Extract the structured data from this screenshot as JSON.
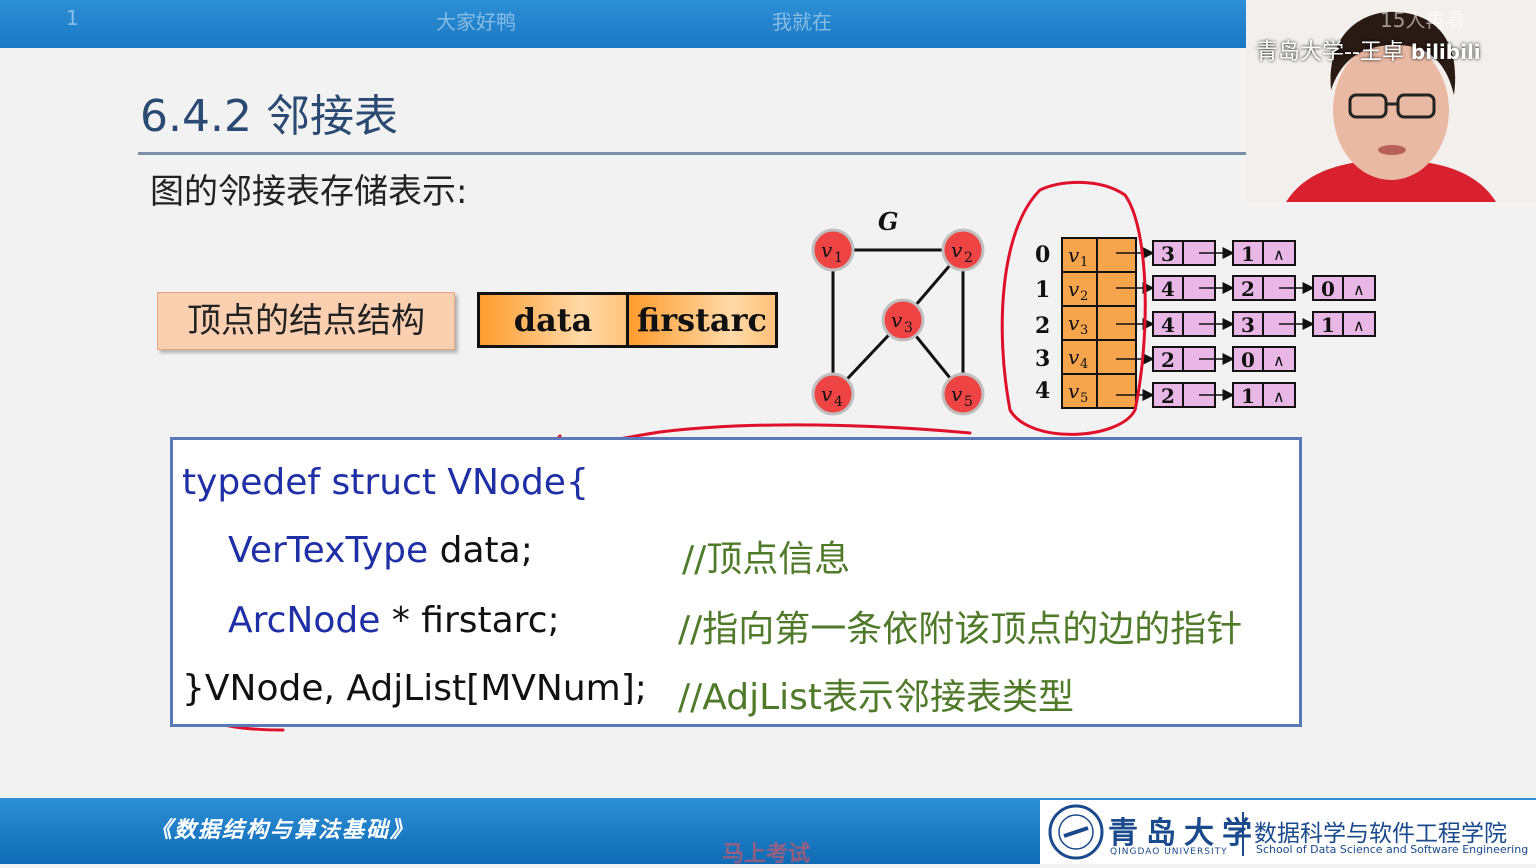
{
  "danmaku": [
    "1",
    "大家好鸭",
    "我就在"
  ],
  "webcam": {
    "caption": "青岛大学--王卓",
    "platform": "bilibili",
    "viewers": "15人再看"
  },
  "slide": {
    "title": "6.4.2 邻接表",
    "subtitle": "图的邻接表存储表示:",
    "struct_label": "顶点的结点结构",
    "node_fields": [
      "data",
      "firstarc"
    ]
  },
  "graph": {
    "name": "G",
    "vertices": [
      {
        "sub": "1"
      },
      {
        "sub": "2"
      },
      {
        "sub": "3"
      },
      {
        "sub": "4"
      },
      {
        "sub": "5"
      }
    ],
    "edges": [
      [
        "1",
        "2"
      ],
      [
        "1",
        "4"
      ],
      [
        "2",
        "3"
      ],
      [
        "2",
        "5"
      ],
      [
        "3",
        "4"
      ],
      [
        "3",
        "5"
      ]
    ]
  },
  "adjacency_list": {
    "indices": [
      "0",
      "1",
      "2",
      "3",
      "4"
    ],
    "rows": [
      {
        "vertex": "1",
        "arcs": [
          "3",
          "1"
        ]
      },
      {
        "vertex": "2",
        "arcs": [
          "4",
          "2",
          "0"
        ]
      },
      {
        "vertex": "3",
        "arcs": [
          "4",
          "3",
          "1"
        ]
      },
      {
        "vertex": "4",
        "arcs": [
          "2",
          "0"
        ]
      },
      {
        "vertex": "5",
        "arcs": [
          "2",
          "1"
        ]
      }
    ],
    "null_symbol": "∧"
  },
  "code": {
    "line1": "typedef struct VNode{",
    "line2_type": "VerTexType",
    "line2_var": " data;",
    "line2_comment": "//顶点信息",
    "line3_type": "ArcNode",
    "line3_var": " * firstarc;",
    "line3_comment": "//指向第一条依附该顶点的边的指针",
    "line4": "}VNode, AdjList[MVNum];",
    "line4_comment": "//AdjList表示邻接表类型"
  },
  "footer": {
    "course": "《数据结构与算法基础》",
    "exam_danmaku": "马上考试",
    "university": "青岛大学",
    "university_en": "QINGDAO UNIVERSITY",
    "school": "数据科学与软件工程学院",
    "school_en": "School of Data Science and Software Engineering"
  },
  "colors": {
    "topbar": "#1a78c4",
    "node_fill": "#ff9c2e",
    "vertex_fill": "#ee4444",
    "adj_fill": "#e8b7e6",
    "annotation": "#e0102a"
  }
}
